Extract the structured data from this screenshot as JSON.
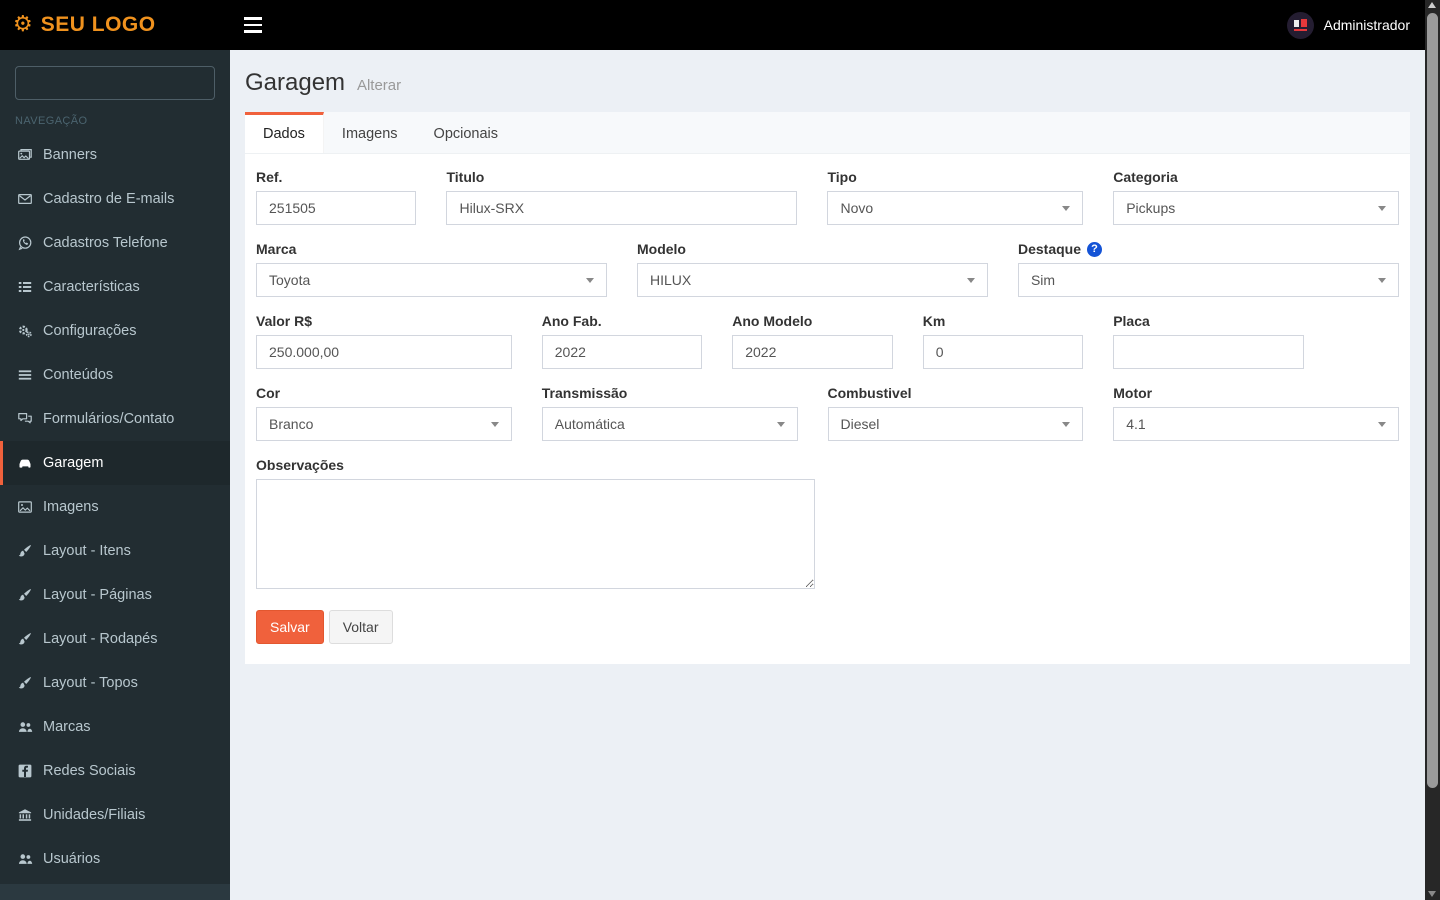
{
  "topbar": {
    "logo": "SEU LOGO",
    "user": "Administrador"
  },
  "sidebar": {
    "search_placeholder": "",
    "nav_label": "NAVEGAÇÃO",
    "items": [
      {
        "label": "Banners",
        "icon": "images-icon",
        "active": false
      },
      {
        "label": "Cadastro de E-mails",
        "icon": "envelope-icon",
        "active": false
      },
      {
        "label": "Cadastros Telefone",
        "icon": "whatsapp-icon",
        "active": false
      },
      {
        "label": "Características",
        "icon": "th-list-icon",
        "active": false
      },
      {
        "label": "Configurações",
        "icon": "gears-icon",
        "active": false
      },
      {
        "label": "Conteúdos",
        "icon": "bars-icon",
        "active": false
      },
      {
        "label": "Formulários/Contato",
        "icon": "comments-icon",
        "active": false
      },
      {
        "label": "Garagem",
        "icon": "car-icon",
        "active": true
      },
      {
        "label": "Imagens",
        "icon": "image-icon",
        "active": false
      },
      {
        "label": "Layout - Itens",
        "icon": "paintbrush-icon",
        "active": false
      },
      {
        "label": "Layout - Páginas",
        "icon": "paintbrush-icon",
        "active": false
      },
      {
        "label": "Layout - Rodapés",
        "icon": "paintbrush-icon",
        "active": false
      },
      {
        "label": "Layout - Topos",
        "icon": "paintbrush-icon",
        "active": false
      },
      {
        "label": "Marcas",
        "icon": "users-icon",
        "active": false
      },
      {
        "label": "Redes Sociais",
        "icon": "facebook-icon",
        "active": false
      },
      {
        "label": "Unidades/Filiais",
        "icon": "bank-icon",
        "active": false
      },
      {
        "label": "Usuários",
        "icon": "users-icon",
        "active": false
      }
    ]
  },
  "header": {
    "title": "Garagem",
    "subtitle": "Alterar"
  },
  "tabs": [
    {
      "label": "Dados",
      "active": true
    },
    {
      "label": "Imagens",
      "active": false
    },
    {
      "label": "Opcionais",
      "active": false
    }
  ],
  "form": {
    "ref": {
      "label": "Ref.",
      "value": "251505"
    },
    "titulo": {
      "label": "Titulo",
      "value": "Hilux-SRX"
    },
    "tipo": {
      "label": "Tipo",
      "value": "Novo"
    },
    "categoria": {
      "label": "Categoria",
      "value": "Pickups"
    },
    "marca": {
      "label": "Marca",
      "value": "Toyota"
    },
    "modelo": {
      "label": "Modelo",
      "value": "HILUX"
    },
    "destaque": {
      "label": "Destaque",
      "value": "Sim",
      "help": "?"
    },
    "valor": {
      "label": "Valor R$",
      "value": "250.000,00"
    },
    "ano_fab": {
      "label": "Ano Fab.",
      "value": "2022"
    },
    "ano_modelo": {
      "label": "Ano Modelo",
      "value": "2022"
    },
    "km": {
      "label": "Km",
      "value": "0"
    },
    "placa": {
      "label": "Placa",
      "value": ""
    },
    "cor": {
      "label": "Cor",
      "value": "Branco"
    },
    "transmissao": {
      "label": "Transmissão",
      "value": "Automática"
    },
    "combustivel": {
      "label": "Combustivel",
      "value": "Diesel"
    },
    "motor": {
      "label": "Motor",
      "value": "4.1"
    },
    "observacoes": {
      "label": "Observações",
      "value": ""
    },
    "save_label": "Salvar",
    "back_label": "Voltar"
  },
  "colors": {
    "accent": "#f0613c",
    "logo_orange": "#f0921e",
    "help_blue": "#1453d6"
  }
}
